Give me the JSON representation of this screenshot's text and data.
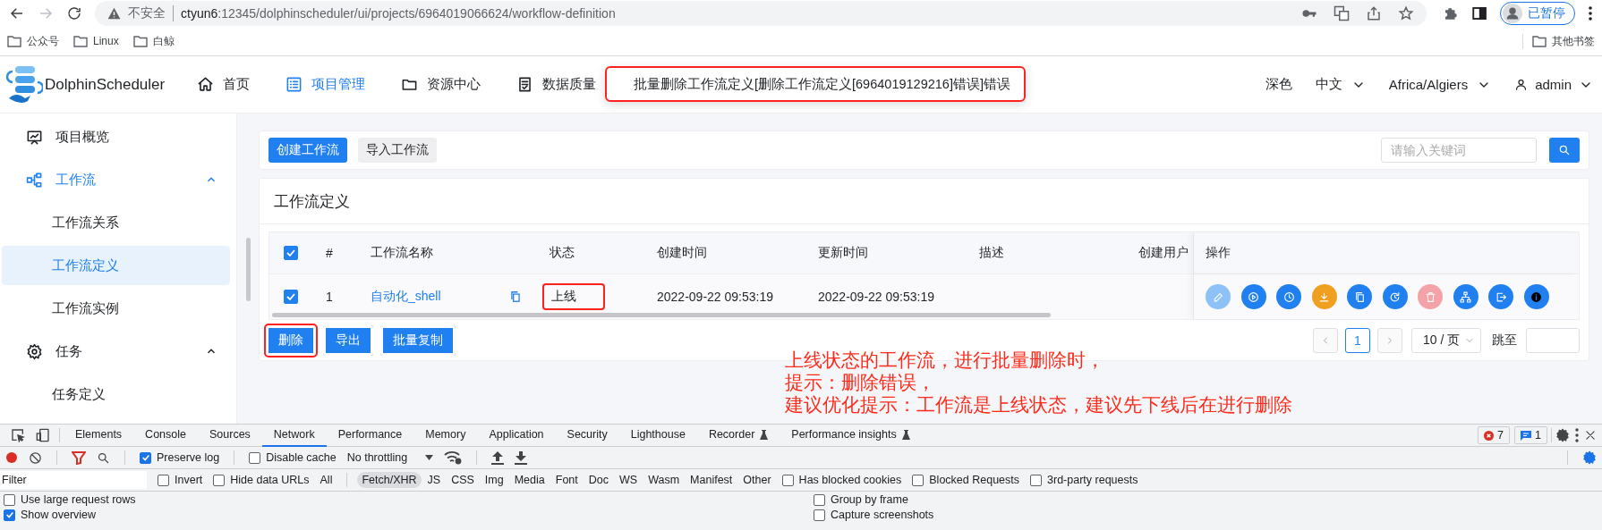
{
  "browser": {
    "back_disabled": false,
    "forward_disabled": true,
    "security": "不安全",
    "url_host": "ctyun6",
    "url_rest": ":12345/dolphinscheduler/ui/projects/6964019066624/workflow-definition",
    "profile": "已暂停"
  },
  "bookmarks": [
    {
      "label": "公众号"
    },
    {
      "label": "Linux"
    },
    {
      "label": "白鲸"
    }
  ],
  "other_bookmarks": "其他书签",
  "header": {
    "logo": "DolphinScheduler",
    "nav": [
      {
        "label": "首页",
        "selected": false
      },
      {
        "label": "项目管理",
        "selected": true
      },
      {
        "label": "资源中心",
        "selected": false
      },
      {
        "label": "数据质量",
        "selected": false
      }
    ],
    "theme": "深色",
    "language": "中文",
    "timezone": "Africa/Algiers",
    "user": "admin"
  },
  "toast": {
    "message": "批量删除工作流定义[删除工作流定义[6964019129216]错误]错误",
    "annotated": true
  },
  "sidebar": {
    "items": [
      {
        "label": "项目概览",
        "selected": false
      },
      {
        "label": "工作流",
        "selected": true,
        "expanded": true,
        "children": [
          {
            "label": "工作流关系",
            "selected": false
          },
          {
            "label": "工作流定义",
            "selected": true
          },
          {
            "label": "工作流实例",
            "selected": false
          }
        ]
      },
      {
        "label": "任务",
        "selected": false,
        "expanded": true,
        "children": [
          {
            "label": "任务定义",
            "selected": false
          }
        ]
      }
    ]
  },
  "toolbar": {
    "create": "创建工作流",
    "import": "导入工作流",
    "search_placeholder": "请输入关键词"
  },
  "table": {
    "title": "工作流定义",
    "all_checked": true,
    "columns": [
      "#",
      "工作流名称",
      "状态",
      "创建时间",
      "更新时间",
      "描述",
      "创建用户",
      "操作"
    ],
    "rows": [
      {
        "checked": true,
        "index": "1",
        "name": "自动化_shell",
        "status": "上线",
        "status_annotated": true,
        "created": "2022-09-22 09:53:19",
        "updated": "2022-09-22 09:53:19",
        "actions": [
          {
            "kind": "edit",
            "disabled": true
          },
          {
            "kind": "run",
            "disabled": false
          },
          {
            "kind": "timing",
            "disabled": false
          },
          {
            "kind": "download",
            "disabled": false
          },
          {
            "kind": "copy",
            "disabled": false
          },
          {
            "kind": "history",
            "disabled": false
          },
          {
            "kind": "delete",
            "disabled": true
          },
          {
            "kind": "tree",
            "disabled": false
          },
          {
            "kind": "export",
            "disabled": false
          },
          {
            "kind": "info",
            "disabled": false
          }
        ]
      }
    ]
  },
  "bulk_actions": [
    {
      "label": "删除",
      "annotated": true
    },
    {
      "label": "导出",
      "annotated": false
    },
    {
      "label": "批量复制",
      "annotated": false
    }
  ],
  "pagination": {
    "page": "1",
    "page_size": "10 / 页",
    "jump": "跳至"
  },
  "note": [
    "上线状态的工作流，进行批量删除时，",
    "提示：删除错误，",
    "建议优化提示：工作流是上线状态，建议先下线后在进行删除"
  ],
  "devtools": {
    "tabs": [
      {
        "label": "Elements",
        "selected": false,
        "experimental": false
      },
      {
        "label": "Console",
        "selected": false,
        "experimental": false
      },
      {
        "label": "Sources",
        "selected": false,
        "experimental": false
      },
      {
        "label": "Network",
        "selected": true,
        "experimental": false
      },
      {
        "label": "Performance",
        "selected": false,
        "experimental": false
      },
      {
        "label": "Memory",
        "selected": false,
        "experimental": false
      },
      {
        "label": "Application",
        "selected": false,
        "experimental": false
      },
      {
        "label": "Security",
        "selected": false,
        "experimental": false
      },
      {
        "label": "Lighthouse",
        "selected": false,
        "experimental": false
      },
      {
        "label": "Recorder",
        "selected": false,
        "experimental": true
      },
      {
        "label": "Performance insights",
        "selected": false,
        "experimental": true
      }
    ],
    "errors": "7",
    "messages": "1",
    "preserve_log": {
      "label": "Preserve log",
      "checked": true
    },
    "disable_cache": {
      "label": "Disable cache",
      "checked": false
    },
    "throttling": "No throttling",
    "filter_placeholder": "Filter",
    "invert": {
      "label": "Invert",
      "checked": false
    },
    "hide_data_urls": {
      "label": "Hide data URLs",
      "checked": false
    },
    "types": [
      {
        "label": "All",
        "selected": false
      },
      {
        "label": "Fetch/XHR",
        "selected": true
      },
      {
        "label": "JS",
        "selected": false
      },
      {
        "label": "CSS",
        "selected": false
      },
      {
        "label": "Img",
        "selected": false
      },
      {
        "label": "Media",
        "selected": false
      },
      {
        "label": "Font",
        "selected": false
      },
      {
        "label": "Doc",
        "selected": false
      },
      {
        "label": "WS",
        "selected": false
      },
      {
        "label": "Wasm",
        "selected": false
      },
      {
        "label": "Manifest",
        "selected": false
      },
      {
        "label": "Other",
        "selected": false
      }
    ],
    "extra_filters": [
      {
        "label": "Has blocked cookies",
        "checked": false
      },
      {
        "label": "Blocked Requests",
        "checked": false
      },
      {
        "label": "3rd-party requests",
        "checked": false
      }
    ],
    "settings": [
      {
        "label": "Use large request rows",
        "checked": false
      },
      {
        "label": "Group by frame",
        "checked": false
      },
      {
        "label": "Show overview",
        "checked": true
      },
      {
        "label": "Capture screenshots",
        "checked": false
      }
    ]
  }
}
